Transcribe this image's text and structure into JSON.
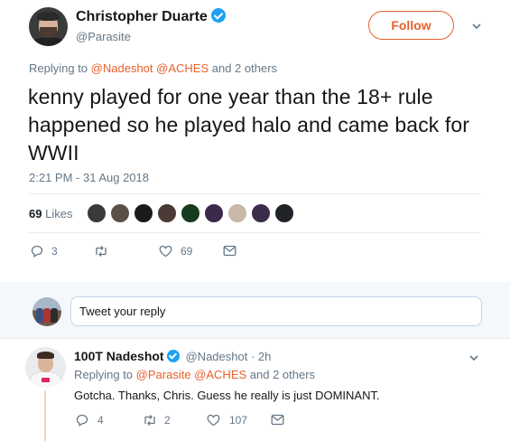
{
  "main_tweet": {
    "author_name": "Christopher Duarte",
    "author_handle": "@Parasite",
    "follow_label": "Follow",
    "replying_prefix": "Replying to",
    "replying_mentions": "@Nadeshot @ACHES",
    "replying_suffix": "and 2 others",
    "text": "kenny played for one year than the 18+ rule happened so he played halo and came back for WWII",
    "timestamp": "2:21 PM - 31 Aug 2018",
    "likes_number": "69",
    "likes_label": "Likes",
    "actions": {
      "reply_count": "3",
      "retweet_count": "",
      "like_count": "69"
    }
  },
  "liker_colors": [
    "#3a3a3a",
    "#5b5048",
    "#1b1b1b",
    "#4b3a35",
    "#173b1e",
    "#3c2a4a",
    "#c9b7a7",
    "#3a2d4a",
    "#202428"
  ],
  "composer": {
    "placeholder": "Tweet your reply"
  },
  "reply_tweet": {
    "author_name": "100T Nadeshot",
    "author_handle": "@Nadeshot · 2h",
    "replying_prefix": "Replying to",
    "replying_mentions": "@Parasite @ACHES",
    "replying_suffix": "and 2 others",
    "text": "Gotcha. Thanks, Chris. Guess he really is just DOMINANT.",
    "actions": {
      "reply_count": "4",
      "retweet_count": "2",
      "like_count": "107"
    }
  },
  "colors": {
    "accent": "#e8602c",
    "verified": "#1da1f2",
    "muted": "#657786",
    "divider": "#e6ecf0"
  },
  "icons": [
    "verified-badge-icon",
    "chevron-down-icon",
    "reply-icon",
    "retweet-icon",
    "heart-icon",
    "message-icon"
  ]
}
